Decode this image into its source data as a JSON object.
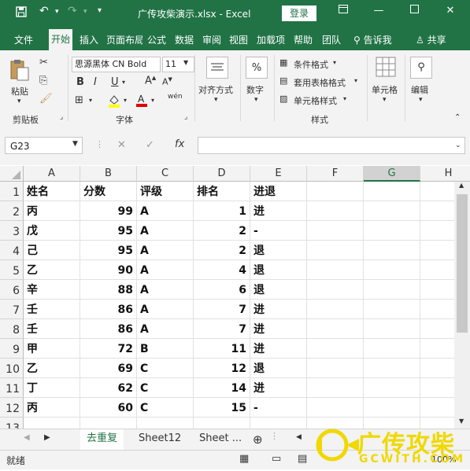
{
  "titlebar": {
    "filename": "广传攻柴演示.xlsx",
    "separator": "-",
    "app": "Excel",
    "login": "登录"
  },
  "tabs": [
    "文件",
    "开始",
    "插入",
    "页面布局",
    "公式",
    "数据",
    "审阅",
    "视图",
    "加载项",
    "帮助",
    "团队",
    "告诉我",
    "共享"
  ],
  "ribbon": {
    "clipboard": {
      "paste": "粘贴",
      "group": "剪贴板"
    },
    "font": {
      "name": "思源黑体 CN Bold",
      "size": "11",
      "group": "字体",
      "bold": "B",
      "italic": "I",
      "underline": "U",
      "wen": "wén"
    },
    "alignment": {
      "label": "对齐方式"
    },
    "number": {
      "label": "数字",
      "symbol": "%"
    },
    "styles": {
      "cond": "条件格式",
      "table": "套用表格格式",
      "cell": "单元格样式",
      "group": "样式"
    },
    "cells": {
      "label": "单元格"
    },
    "editing": {
      "label": "编辑"
    }
  },
  "formula_bar": {
    "name_box": "G23",
    "fx": "fx",
    "value": ""
  },
  "columns": [
    "A",
    "B",
    "C",
    "D",
    "E",
    "F",
    "G",
    "H"
  ],
  "selected_column": "G",
  "rows": [
    {
      "n": "1",
      "a": "姓名",
      "b": "分数",
      "c": "评级",
      "d": "排名",
      "e": "进退"
    },
    {
      "n": "2",
      "a": "丙",
      "b": "99",
      "c": "A",
      "d": "1",
      "e": "进"
    },
    {
      "n": "3",
      "a": "戊",
      "b": "95",
      "c": "A",
      "d": "2",
      "e": "-"
    },
    {
      "n": "4",
      "a": "己",
      "b": "95",
      "c": "A",
      "d": "2",
      "e": "退"
    },
    {
      "n": "5",
      "a": "乙",
      "b": "90",
      "c": "A",
      "d": "4",
      "e": "退"
    },
    {
      "n": "6",
      "a": "辛",
      "b": "88",
      "c": "A",
      "d": "6",
      "e": "退"
    },
    {
      "n": "7",
      "a": "壬",
      "b": "86",
      "c": "A",
      "d": "7",
      "e": "进"
    },
    {
      "n": "8",
      "a": "壬",
      "b": "86",
      "c": "A",
      "d": "7",
      "e": "进"
    },
    {
      "n": "9",
      "a": "甲",
      "b": "72",
      "c": "B",
      "d": "11",
      "e": "进"
    },
    {
      "n": "10",
      "a": "乙",
      "b": "69",
      "c": "C",
      "d": "12",
      "e": "退"
    },
    {
      "n": "11",
      "a": "丁",
      "b": "62",
      "c": "C",
      "d": "14",
      "e": "进"
    },
    {
      "n": "12",
      "a": "丙",
      "b": "60",
      "c": "C",
      "d": "15",
      "e": "-"
    },
    {
      "n": "13",
      "a": "",
      "b": "",
      "c": "",
      "d": "",
      "e": ""
    }
  ],
  "sheets": [
    "去重复",
    "Sheet12",
    "Sheet ..."
  ],
  "status": {
    "ready": "就绪",
    "zoom": "100%"
  },
  "watermark": {
    "cn": "广传攻柴",
    "en": "GCWITH.COM"
  },
  "colors": {
    "excel_green": "#217346",
    "watermark": "#f0d800"
  }
}
